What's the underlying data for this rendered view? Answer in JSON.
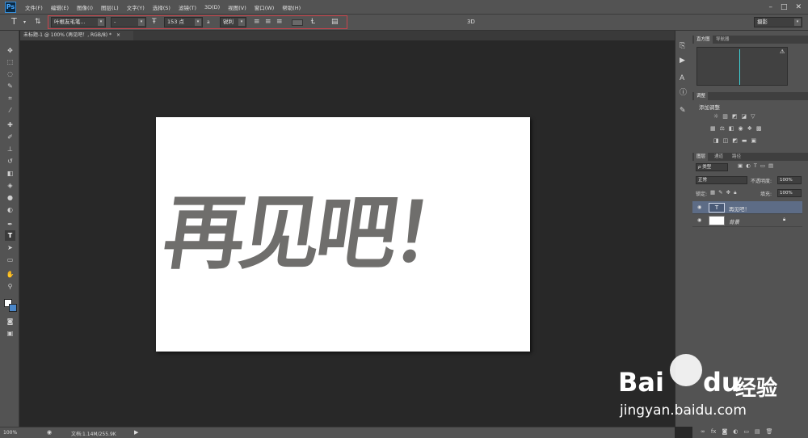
{
  "app": {
    "logo": "Ps"
  },
  "menu": [
    "文件(F)",
    "编辑(E)",
    "图像(I)",
    "图层(L)",
    "文字(Y)",
    "选择(S)",
    "滤镜(T)",
    "3D(D)",
    "视图(V)",
    "窗口(W)",
    "帮助(H)"
  ],
  "options": {
    "tool_glyph": "T",
    "font_family": "叶根友毛笔...",
    "font_style": "-",
    "font_size": "153 点",
    "aa_label": "a",
    "anti_alias": "锐利",
    "mode_3d": "3D",
    "workspace": "摄影"
  },
  "document": {
    "tab_title": "未标题-1 @ 100% (再见吧！, RGB/8) *",
    "close": "×"
  },
  "canvas_text": "再见吧！",
  "status": {
    "zoom": "100%",
    "doc_size": "文档:1.14M/255.9K"
  },
  "panels": {
    "histogram_tabs": [
      "直方图",
      "导航器"
    ],
    "adjust_tab": "调整",
    "adjust_add": "添加调整",
    "layer_tabs": [
      "图层",
      "通道",
      "路径"
    ],
    "kind_filter": "ρ 类型",
    "blend_mode": "正常",
    "opacity_label": "不透明度:",
    "opacity_value": "100%",
    "lock_label": "锁定:",
    "fill_label": "填充:",
    "fill_value": "100%",
    "layers": [
      {
        "name": "再见吧！",
        "type": "text",
        "selected": true
      },
      {
        "name": "背景",
        "type": "background",
        "selected": false
      }
    ]
  },
  "watermark": {
    "brand_a": "Bai",
    "brand_b": "du",
    "brand_c": "经验",
    "url": "jingyan.baidu.com"
  }
}
